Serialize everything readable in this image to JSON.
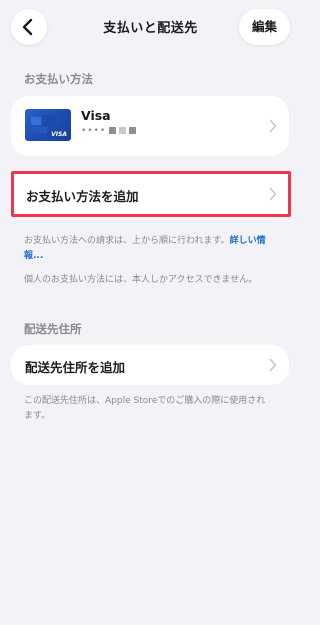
{
  "nav": {
    "title": "支払いと配送先",
    "edit_label": "編集"
  },
  "payment": {
    "section_title": "お支払い方法",
    "card_name": "Visa",
    "card_number_mask": "••••",
    "card_brand_mark": "VISA",
    "add_label": "お支払い方法を追加",
    "note1_text": "お支払い方法への請求は、上から順に行われます。",
    "note1_link": "詳しい情報...",
    "note2": "個人のお支払い方法には、本人しかアクセスできません。"
  },
  "shipping": {
    "section_title": "配送先住所",
    "add_label": "配送先住所を追加",
    "note": "この配送先住所は、Apple Storeでのご購入の際に使用されます。"
  },
  "colors": {
    "background": "#f2f2f7",
    "highlight": "#f0364f",
    "link": "#1f6fd6",
    "card": "#2a62c8"
  },
  "icons": {
    "back": "chevron-left-icon",
    "row": "chevron-right-icon"
  }
}
